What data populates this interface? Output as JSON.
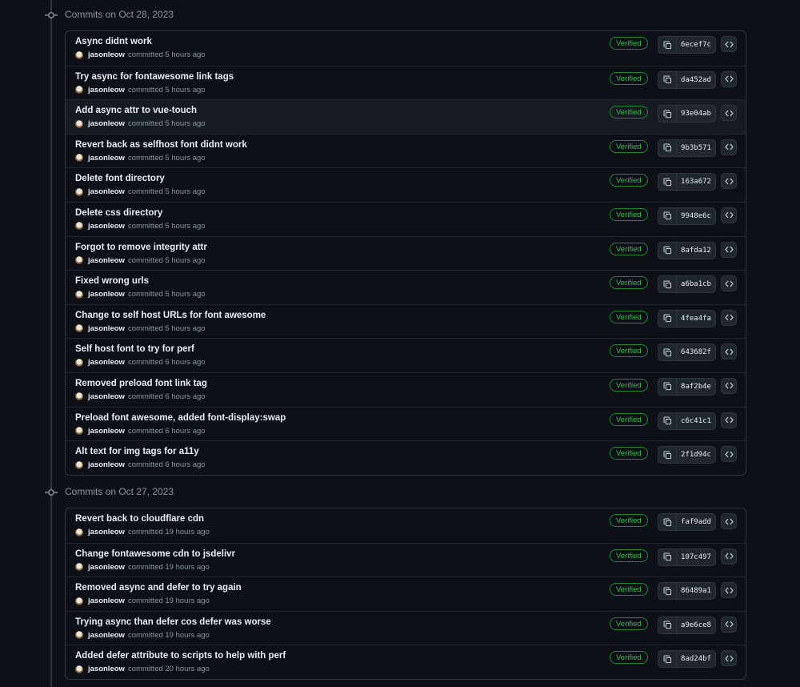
{
  "groups": [
    {
      "title": "Commits on Oct 28, 2023",
      "commits": [
        {
          "message": "Async didnt work",
          "author": "jasonleow",
          "time": "committed 5 hours ago",
          "badge": "Verified",
          "sha": "6ecef7c"
        },
        {
          "message": "Try async for fontawesome link tags",
          "author": "jasonleow",
          "time": "committed 5 hours ago",
          "badge": "Verified",
          "sha": "da452ad"
        },
        {
          "message": "Add async attr to vue-touch",
          "author": "jasonleow",
          "time": "committed 5 hours ago",
          "badge": "Verified",
          "sha": "93e04ab"
        },
        {
          "message": "Revert back as selfhost font didnt work",
          "author": "jasonleow",
          "time": "committed 5 hours ago",
          "badge": "Verified",
          "sha": "9b3b571"
        },
        {
          "message": "Delete font directory",
          "author": "jasonleow",
          "time": "committed 5 hours ago",
          "badge": "Verified",
          "sha": "163a672"
        },
        {
          "message": "Delete css directory",
          "author": "jasonleow",
          "time": "committed 5 hours ago",
          "badge": "Verified",
          "sha": "9948e6c"
        },
        {
          "message": "Forgot to remove integrity attr",
          "author": "jasonleow",
          "time": "committed 5 hours ago",
          "badge": "Verified",
          "sha": "8afda12"
        },
        {
          "message": "Fixed wrong urls",
          "author": "jasonleow",
          "time": "committed 5 hours ago",
          "badge": "Verified",
          "sha": "a6ba1cb"
        },
        {
          "message": "Change to self host URLs for font awesome",
          "author": "jasonleow",
          "time": "committed 5 hours ago",
          "badge": "Verified",
          "sha": "4fea4fa"
        },
        {
          "message": "Self host font to try for perf",
          "author": "jasonleow",
          "time": "committed 6 hours ago",
          "badge": "Verified",
          "sha": "643682f"
        },
        {
          "message": "Removed preload font link tag",
          "author": "jasonleow",
          "time": "committed 6 hours ago",
          "badge": "Verified",
          "sha": "8af2b4e"
        },
        {
          "message": "Preload font awesome, added font-display:swap",
          "author": "jasonleow",
          "time": "committed 6 hours ago",
          "badge": "Verified",
          "sha": "c6c41c1"
        },
        {
          "message": "Alt text for img tags for a11y",
          "author": "jasonleow",
          "time": "committed 6 hours ago",
          "badge": "Verified",
          "sha": "2f1d94c"
        }
      ]
    },
    {
      "title": "Commits on Oct 27, 2023",
      "commits": [
        {
          "message": "Revert back to cloudflare cdn",
          "author": "jasonleow",
          "time": "committed 19 hours ago",
          "badge": "Verified",
          "sha": "faf9add"
        },
        {
          "message": "Change fontawesome cdn to jsdelivr",
          "author": "jasonleow",
          "time": "committed 19 hours ago",
          "badge": "Verified",
          "sha": "107c497"
        },
        {
          "message": "Removed async and defer to try again",
          "author": "jasonleow",
          "time": "committed 19 hours ago",
          "badge": "Verified",
          "sha": "86489a1"
        },
        {
          "message": "Trying async than defer cos defer was worse",
          "author": "jasonleow",
          "time": "committed 19 hours ago",
          "badge": "Verified",
          "sha": "a9e6ce8"
        },
        {
          "message": "Added defer attribute to scripts to help with perf",
          "author": "jasonleow",
          "time": "committed 20 hours ago",
          "badge": "Verified",
          "sha": "8ad24bf"
        }
      ]
    }
  ]
}
